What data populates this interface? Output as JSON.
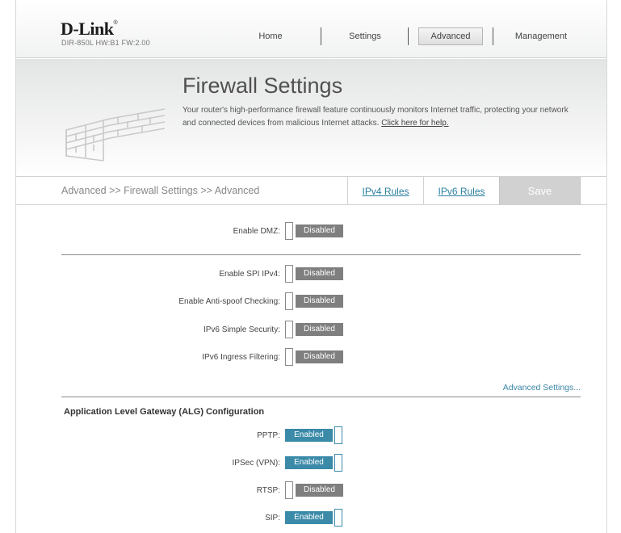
{
  "header": {
    "logo_text": "D-Link",
    "logo_mark": "®",
    "hw_info": "DIR-850L   HW:B1   FW:2.00",
    "nav": [
      {
        "label": "Home"
      },
      {
        "label": "Settings"
      },
      {
        "label": "Advanced",
        "active": true
      },
      {
        "label": "Management"
      }
    ]
  },
  "banner": {
    "title": "Firewall Settings",
    "description": "Your router's high-performance firewall feature continuously monitors Internet traffic, protecting your network and connected devices from malicious Internet attacks. ",
    "help_link": "Click here for help."
  },
  "subnav": {
    "breadcrumb": "Advanced >> Firewall Settings >> Advanced",
    "tabs": [
      {
        "label": "IPv4 Rules"
      },
      {
        "label": "IPv6 Rules"
      }
    ],
    "save_label": "Save"
  },
  "dmz": {
    "label": "Enable DMZ:",
    "state": "Disabled"
  },
  "security": {
    "rows": [
      {
        "label": "Enable SPI IPv4:",
        "state": "Disabled"
      },
      {
        "label": "Enable Anti-spoof Checking:",
        "state": "Disabled"
      },
      {
        "label": "IPv6 Simple Security:",
        "state": "Disabled"
      },
      {
        "label": "IPv6 Ingress Filtering:",
        "state": "Disabled"
      }
    ],
    "advanced_link": "Advanced Settings..."
  },
  "alg": {
    "title": "Application Level Gateway (ALG) Configuration",
    "rows": [
      {
        "label": "PPTP:",
        "state": "Enabled"
      },
      {
        "label": "IPSec (VPN):",
        "state": "Enabled"
      },
      {
        "label": "RTSP:",
        "state": "Disabled"
      },
      {
        "label": "SIP:",
        "state": "Enabled"
      }
    ]
  },
  "colors": {
    "accent": "#3a8aa8",
    "toggle_off": "#7f7f7f",
    "link": "#2b7fa0",
    "save_bg": "#d1d1d1"
  }
}
